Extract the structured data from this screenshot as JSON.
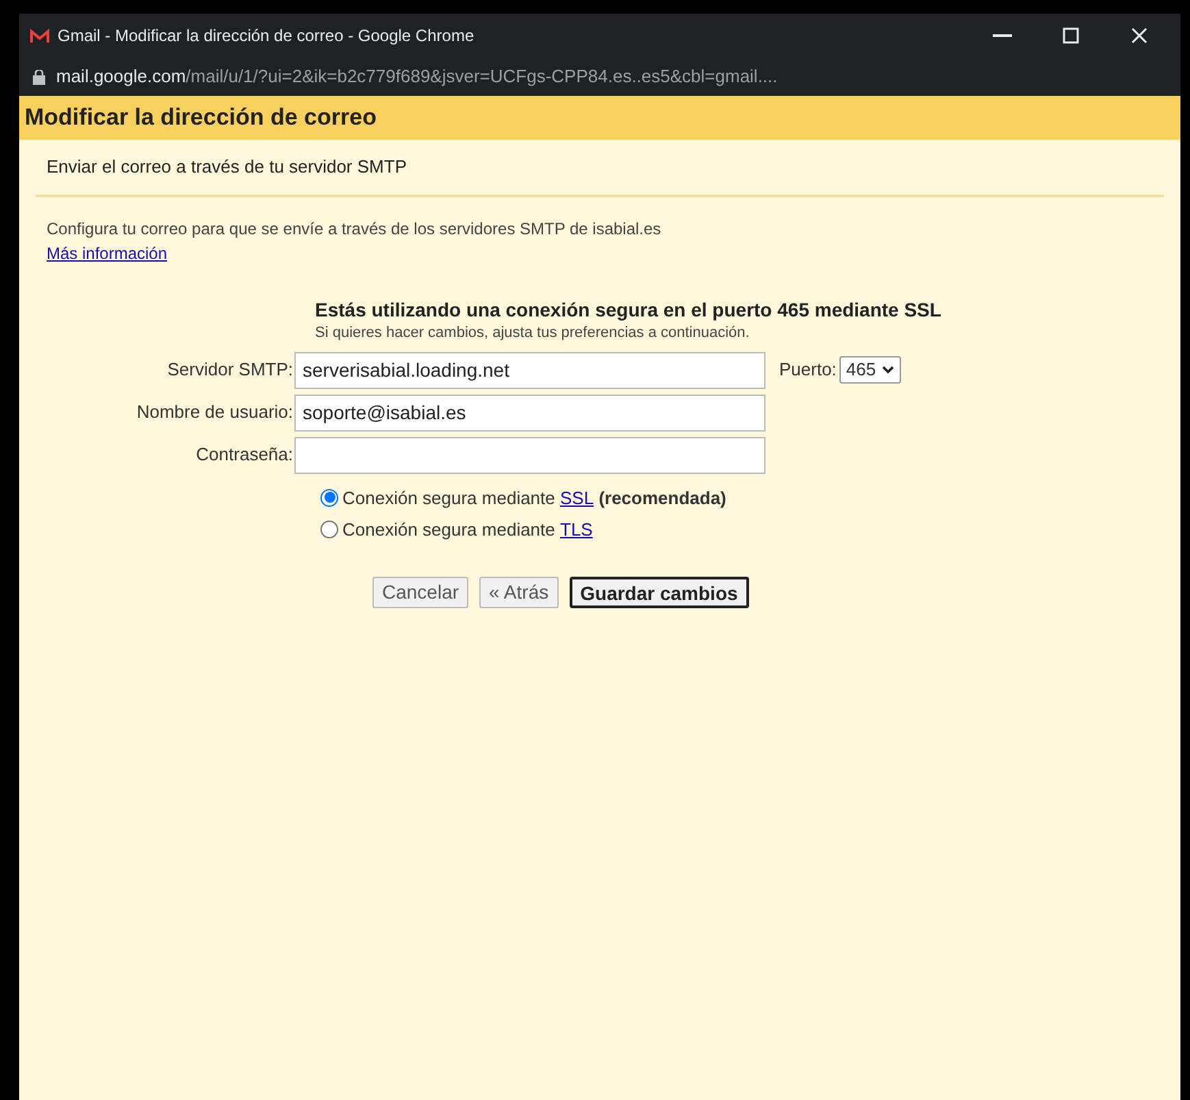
{
  "window": {
    "title": "Gmail - Modificar la dirección de correo - Google Chrome"
  },
  "address_bar": {
    "host": "mail.google.com",
    "path": "/mail/u/1/?ui=2&ik=b2c779f689&jsver=UCFgs-CPP84.es..es5&cbl=gmail...."
  },
  "header": {
    "title": "Modificar la dirección de correo"
  },
  "subheader": "Enviar el correo a través de tu servidor SMTP",
  "intro": "Configura tu correo para que se envíe a través de los servidores SMTP de isabial.es",
  "more_link": "Más información",
  "notice": {
    "title": "Estás utilizando una conexión segura en el puerto 465 mediante SSL",
    "subtitle": "Si quieres hacer cambios, ajusta tus preferencias a continuación."
  },
  "fields": [
    {
      "label": "Servidor SMTP:",
      "value": "serverisabial.loading.net"
    },
    {
      "label": "Nombre de usuario:",
      "value": "soporte@isabial.es"
    },
    {
      "label": "Contraseña:"
    }
  ],
  "port": {
    "label": "Puerto:",
    "value": "465"
  },
  "security": [
    {
      "prefix": "Conexión segura mediante ",
      "link": "SSL",
      "suffix": " (recomendada)",
      "selected": true
    },
    {
      "prefix": "Conexión segura mediante ",
      "link": "TLS",
      "selected": false
    }
  ],
  "buttons": [
    {
      "label": "Cancelar",
      "primary": false
    },
    {
      "label": "« Atrás",
      "primary": false
    },
    {
      "label": "Guardar cambios",
      "primary": true
    }
  ]
}
